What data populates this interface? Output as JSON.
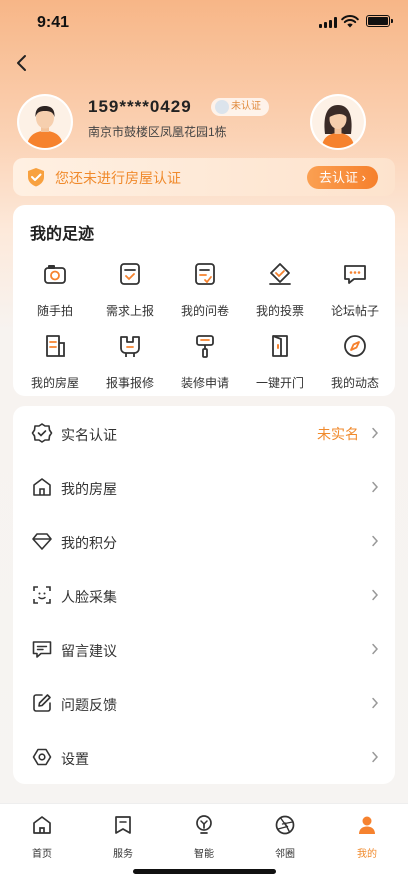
{
  "status_bar": {
    "time": "9:41"
  },
  "profile": {
    "phone": "159****0429",
    "verify_badge": "未认证",
    "address": "南京市鼓楼区凤凰花园1栋"
  },
  "house_banner": {
    "text": "您还未进行房屋认证",
    "button": "去认证 ›"
  },
  "footprint": {
    "title": "我的足迹",
    "items": [
      {
        "label": "随手拍",
        "icon": "camera-icon"
      },
      {
        "label": "需求上报",
        "icon": "report-check-icon"
      },
      {
        "label": "我的问卷",
        "icon": "questionnaire-icon"
      },
      {
        "label": "我的投票",
        "icon": "vote-icon"
      },
      {
        "label": "论坛帖子",
        "icon": "chat-bubble-icon"
      },
      {
        "label": "我的房屋",
        "icon": "house-doc-icon"
      },
      {
        "label": "报事报修",
        "icon": "repair-icon"
      },
      {
        "label": "装修申请",
        "icon": "paint-brush-icon"
      },
      {
        "label": "一键开门",
        "icon": "door-icon"
      },
      {
        "label": "我的动态",
        "icon": "compass-icon"
      }
    ]
  },
  "menu": {
    "items": [
      {
        "label": "实名认证",
        "value": "未实名",
        "icon": "verified-badge-icon"
      },
      {
        "label": "我的房屋",
        "value": "",
        "icon": "house-icon"
      },
      {
        "label": "我的积分",
        "value": "",
        "icon": "diamond-icon"
      },
      {
        "label": "人脸采集",
        "value": "",
        "icon": "face-scan-icon"
      },
      {
        "label": "留言建议",
        "value": "",
        "icon": "message-icon"
      },
      {
        "label": "问题反馈",
        "value": "",
        "icon": "edit-icon"
      },
      {
        "label": "设置",
        "value": "",
        "icon": "settings-icon"
      }
    ]
  },
  "tabbar": {
    "items": [
      {
        "label": "首页",
        "icon": "home-icon",
        "active": false
      },
      {
        "label": "服务",
        "icon": "service-icon",
        "active": false
      },
      {
        "label": "智能",
        "icon": "smart-icon",
        "active": false
      },
      {
        "label": "邻圈",
        "icon": "neighbor-circle-icon",
        "active": false
      },
      {
        "label": "我的",
        "icon": "profile-icon",
        "active": true
      }
    ]
  },
  "colors": {
    "accent": "#f08a2c",
    "header_top": "#f7b687",
    "card": "#ffffff",
    "background": "#f6f4f2"
  }
}
